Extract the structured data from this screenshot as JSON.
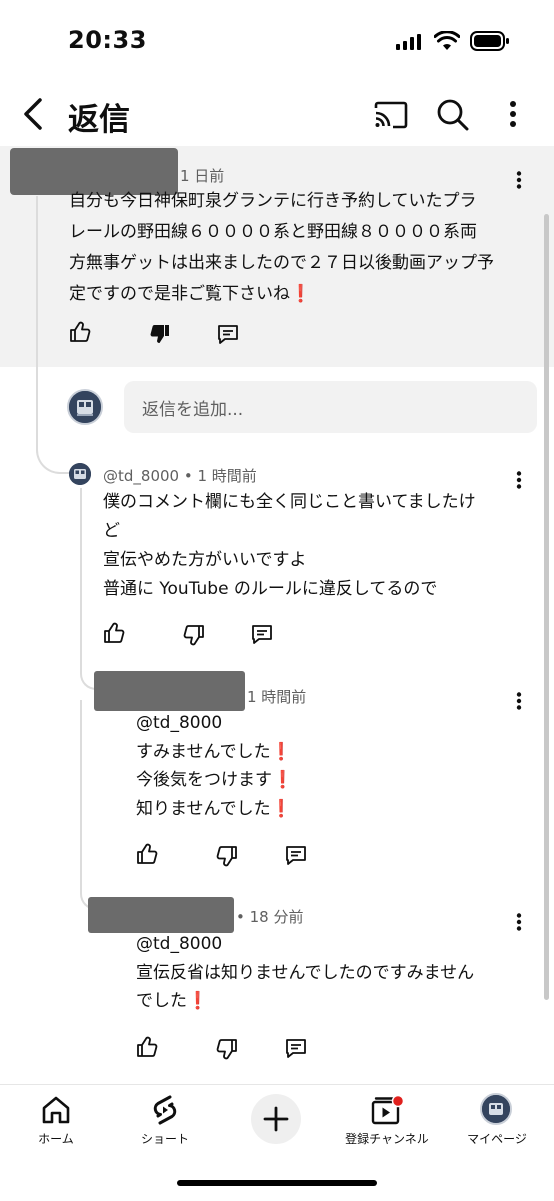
{
  "status_bar": {
    "time": "20:33"
  },
  "header": {
    "title": "返信"
  },
  "top_comment": {
    "time": "1 日前",
    "lines": [
      "自分も今日神保町泉グランテに行き予約していたプラ",
      "レールの野田線６００００系と野田線８００００系両",
      "方無事ゲットは出来ましたので２７日以後動画アップ予",
      "定ですので是非ご覧下さいね"
    ],
    "exclaim": "❗"
  },
  "reply_input": {
    "placeholder": "返信を追加..."
  },
  "replies": [
    {
      "author": "@td_8000",
      "time": "1 時間前",
      "lines": [
        "僕のコメント欄にも全く同じこと書いてましたけ",
        "ど",
        "宣伝やめた方がいいですよ",
        "普通に YouTube のルールに違反してるので"
      ]
    },
    {
      "time": "1 時間前",
      "mention": "@td_8000",
      "lines": [
        "すみませんでした",
        "今後気をつけます",
        "知りませんでした"
      ],
      "exclaim": "❗"
    },
    {
      "time": "18 分前",
      "mention": "@td_8000",
      "lines": [
        "宣伝反省は知りませんでしたのですみません",
        "でした"
      ],
      "exclaim": "❗"
    }
  ],
  "bottom_nav": {
    "home": "ホーム",
    "shorts": "ショート",
    "subscriptions": "登録チャンネル",
    "mypage": "マイページ"
  },
  "colors": {
    "accent_red": "#e0201d",
    "text": "#0f0f0f",
    "meta": "#606060"
  }
}
